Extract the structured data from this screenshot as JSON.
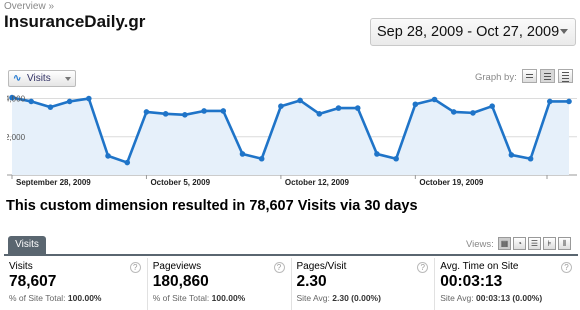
{
  "breadcrumb": "Overview »",
  "site_title": "InsuranceDaily.gr",
  "date_range": "Sep 28, 2009 - Oct 27, 2009",
  "metric_selector": "Visits",
  "graph_by_label": "Graph by:",
  "chart_data": {
    "type": "area",
    "series": [
      {
        "values": [
          4050,
          3850,
          3550,
          3850,
          4000,
          1000,
          650,
          3300,
          3200,
          3150,
          3350,
          3350,
          1100,
          850,
          3600,
          3900,
          3200,
          3500,
          3500,
          1100,
          850,
          3700,
          3950,
          3300,
          3250,
          3600,
          1050,
          850,
          3850,
          3850
        ]
      }
    ],
    "y_ticks": [
      "4,000",
      "2,000"
    ],
    "ylim": [
      0,
      4500
    ],
    "x_tick_labels": [
      "September 28, 2009",
      "October 5, 2009",
      "October 12, 2009",
      "October 19, 2009"
    ],
    "grid": true,
    "colors": {
      "line": "#1f74c8",
      "fill": "#e6f0fa",
      "grid": "#dcdcdc"
    }
  },
  "summary": "This custom dimension resulted in 78,607 Visits via 30 days",
  "tab_label": "Visits",
  "views_label": "Views:",
  "metrics": [
    {
      "name": "Visits",
      "value": "78,607",
      "sub_label": "% of Site Total:",
      "sub_value": "100.00%"
    },
    {
      "name": "Pageviews",
      "value": "180,860",
      "sub_label": "% of Site Total:",
      "sub_value": "100.00%"
    },
    {
      "name": "Pages/Visit",
      "value": "2.30",
      "sub_label": "Site Avg:",
      "sub_value": "2.30 (0.00%)"
    },
    {
      "name": "Avg. Time on Site",
      "value": "00:03:13",
      "sub_label": "Site Avg:",
      "sub_value": "00:03:13 (0.00%)"
    }
  ],
  "help_glyph": "?"
}
